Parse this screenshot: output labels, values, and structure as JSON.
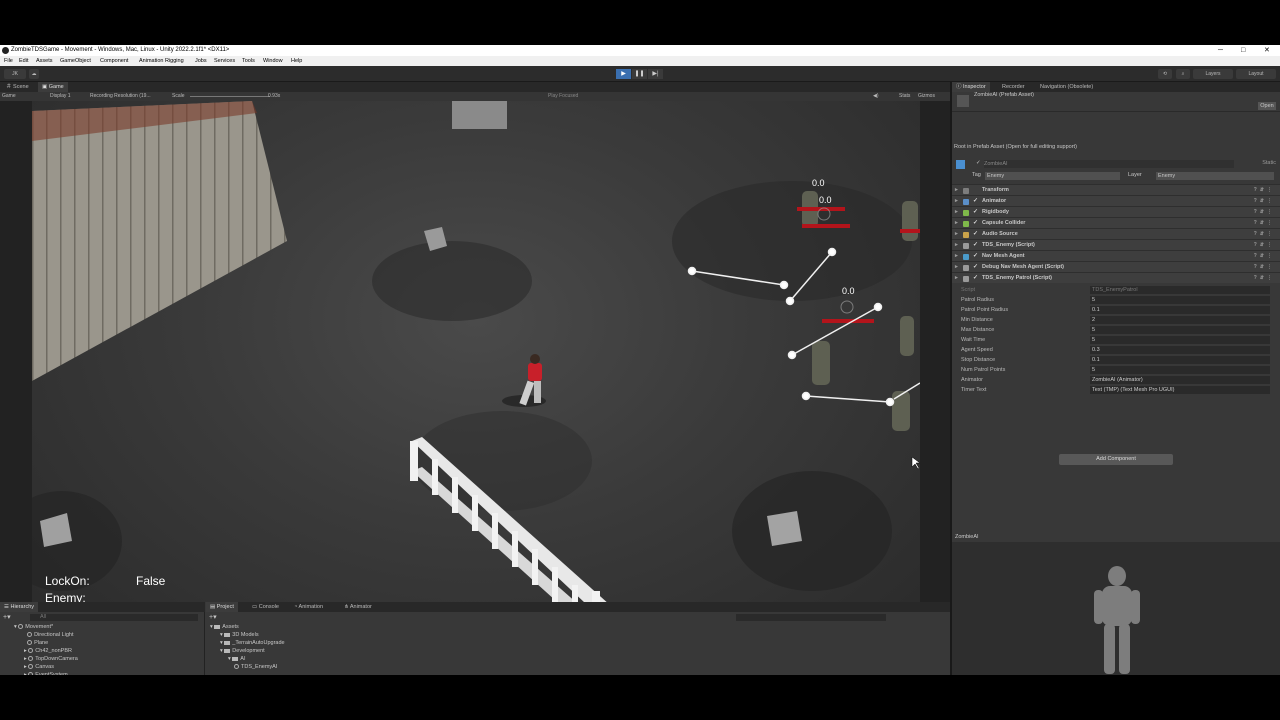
{
  "window": {
    "title": "ZombieTDSGame - Movement - Windows, Mac, Linux - Unity 2022.2.1f1* <DX11>",
    "controls": [
      "─",
      "□",
      "✕"
    ]
  },
  "menu": [
    "File",
    "Edit",
    "Assets",
    "GameObject",
    "Component",
    "Animation Rigging",
    "Jobs",
    "Services",
    "Tools",
    "Window",
    "Help"
  ],
  "toolbar": {
    "account": "JK",
    "layers": "Layers",
    "layout": "Layout",
    "play": "▶",
    "pause": "❚❚",
    "step": "▶|"
  },
  "scene_tabs": {
    "scene": "Scene",
    "game": "Game"
  },
  "game_toolbar": {
    "mode": "Game",
    "display": "Display 1",
    "resolution": "Recording Resolution (19...",
    "scale_label": "Scale",
    "scale_value": "0.93x",
    "play_focused": "Play Focused",
    "stats": "Stats",
    "gizmos": "Gizmos"
  },
  "hud": {
    "lockon_label": "LockOn:",
    "lockon_value": "False",
    "enemy_label": "Enemy:",
    "timers": [
      "0.0",
      "0.0",
      "0.0"
    ]
  },
  "inspector_tabs": {
    "inspector": "Inspector",
    "recorder": "Recorder",
    "navigation": "Navigation (Obsolete)"
  },
  "inspector": {
    "asset_title": "ZombieAI (Prefab Asset)",
    "open_button": "Open",
    "root_note": "Root in Prefab Asset (Open for full editing support)",
    "object_name": "ZombieAI",
    "static_label": "Static",
    "tag_label": "Tag",
    "tag_value": "Enemy",
    "layer_label": "Layer",
    "layer_value": "Enemy",
    "components": [
      {
        "name": "Transform",
        "color": "#7d7d7d"
      },
      {
        "name": "Animator",
        "color": "#5b8fc9"
      },
      {
        "name": "Rigidbody",
        "color": "#7fb94a"
      },
      {
        "name": "Capsule Collider",
        "color": "#7fb94a"
      },
      {
        "name": "Audio Source",
        "color": "#c9a24a"
      },
      {
        "name": "TDS_Enemy (Script)",
        "color": "#9a9a9a"
      },
      {
        "name": "Nav Mesh Agent",
        "color": "#4a9ac9"
      },
      {
        "name": "Debug Nav Mesh Agent (Script)",
        "color": "#9a9a9a"
      },
      {
        "name": "TDS_Enemy Patrol (Script)",
        "color": "#9a9a9a"
      }
    ],
    "properties": [
      {
        "label": "Script",
        "value": "TDS_EnemyPatrol"
      },
      {
        "label": "Patrol Radius",
        "value": "5"
      },
      {
        "label": "Patrol Point Radius",
        "value": "0.1"
      },
      {
        "label": "Min Distance",
        "value": "2"
      },
      {
        "label": "Max Distance",
        "value": "5"
      },
      {
        "label": "Wait Time",
        "value": "5"
      },
      {
        "label": "Agent Speed",
        "value": "0.3"
      },
      {
        "label": "Stop Distance",
        "value": "0.1"
      },
      {
        "label": "Num Patrol Points",
        "value": "5"
      },
      {
        "label": "Animator",
        "value": "ZombieAI (Animator)"
      },
      {
        "label": "Timer Text",
        "value": "Text (TMP) (Text Mesh Pro UGUI)"
      }
    ],
    "add_component": "Add Component"
  },
  "preview": {
    "title": "ZombieAI"
  },
  "hierarchy": {
    "tab": "Hierarchy",
    "search_placeholder": "All",
    "scene": "Movement*",
    "items": [
      "Directional Light",
      "Plane",
      "Ch42_nonPBR",
      "TopDownCamera",
      "Canvas",
      "EventSystem"
    ]
  },
  "project": {
    "tabs": [
      "Project",
      "Console",
      "Animation",
      "Animator"
    ],
    "tree": [
      "Assets",
      "3D Models",
      "_TerrainAutoUpgrade",
      "Development",
      "AI",
      "TDS_EnemyAI"
    ]
  }
}
